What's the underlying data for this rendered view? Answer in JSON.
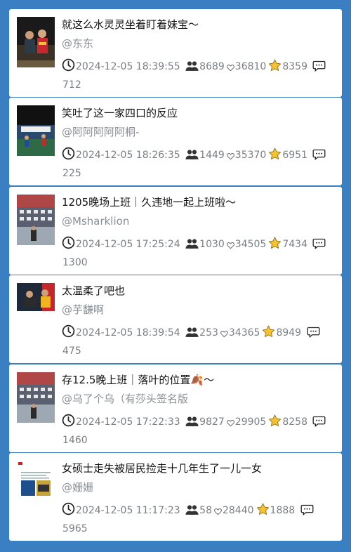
{
  "posts": [
    {
      "title": "就这么水灵灵坐着盯着妹宝～",
      "author": "@东东",
      "time": "2024-12-05 18:39:55",
      "views": "8689",
      "likes": "36810",
      "favorites": "8359",
      "comments": "712",
      "thumb": "photo-people"
    },
    {
      "title": "笑吐了这一家四口的反应",
      "author": "@阿阿阿阿阿桐-",
      "time": "2024-12-05 18:26:35",
      "views": "1449",
      "likes": "35370",
      "favorites": "6951",
      "comments": "225",
      "thumb": "photo-arena"
    },
    {
      "title": "1205晚场上班｜久违地一起上班啦～",
      "author": "@Msharklion",
      "time": "2024-12-05 17:25:24",
      "views": "1030",
      "likes": "34505",
      "favorites": "7434",
      "comments": "1300",
      "thumb": "photo-stands"
    },
    {
      "title": "太温柔了吧也",
      "author": "@芋馦啊",
      "time": "2024-12-05 18:39:54",
      "views": "253",
      "likes": "34365",
      "favorites": "8949",
      "comments": "475",
      "thumb": "photo-players"
    },
    {
      "title": "存12.5晚上班｜落叶的位置🍂～",
      "author": "@乌了个乌（有莎头签名版",
      "time": "2024-12-05 17:22:33",
      "views": "9827",
      "likes": "29905",
      "favorites": "8258",
      "comments": "1460",
      "thumb": "photo-stands"
    },
    {
      "title": "女硕士走失被居民捡走十几年生了一儿一女",
      "author": "@姗姗",
      "time": "2024-12-05 11:17:23",
      "views": "58",
      "likes": "28440",
      "favorites": "1888",
      "comments": "5965",
      "thumb": "photo-document"
    }
  ],
  "icons": {
    "time": "clock-icon",
    "views": "people-icon",
    "likes": "heart-icon",
    "favorites": "star-icon",
    "comments": "comment-icon"
  }
}
